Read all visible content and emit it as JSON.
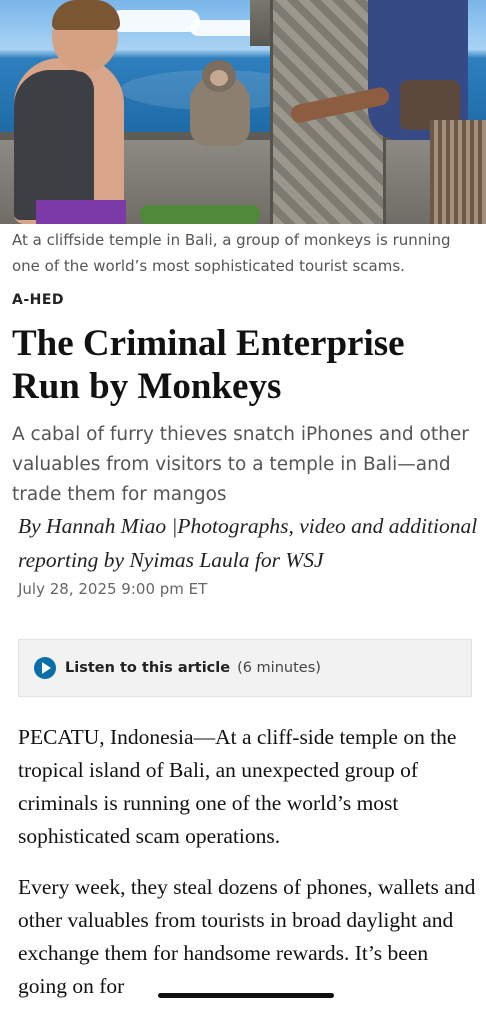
{
  "hero": {
    "alt_icon": "photo-monkey-temple"
  },
  "caption": "At a cliffside temple in Bali, a group of monkeys is running one of the world’s most sophisticated tourist scams.",
  "kicker": "A-HED",
  "headline": "The Criminal Enterprise Run by Monkeys",
  "dek": "A cabal of furry thieves snatch iPhones and other valuables from visitors to a temple in Bali—and trade them for mangos",
  "byline": "By Hannah Miao |Photographs, video and additional reporting by Nyimas Laula for WSJ",
  "dateline": "July 28, 2025 9:00 pm ET",
  "listen": {
    "label": "Listen to this article",
    "duration": "(6 minutes)",
    "icon": "play-icon",
    "accent": "#0a6ea8"
  },
  "body": {
    "paragraphs": [
      "PECATU, Indonesia—At a cliff-side temple on the tropical island of Bali, an unexpected group of criminals is running one of the world’s most sophisticated scam operations.",
      "Every week, they steal dozens of phones, wallets and other valuables from tourists in broad daylight and exchange them for handsome rewards. It’s been going on for"
    ]
  }
}
